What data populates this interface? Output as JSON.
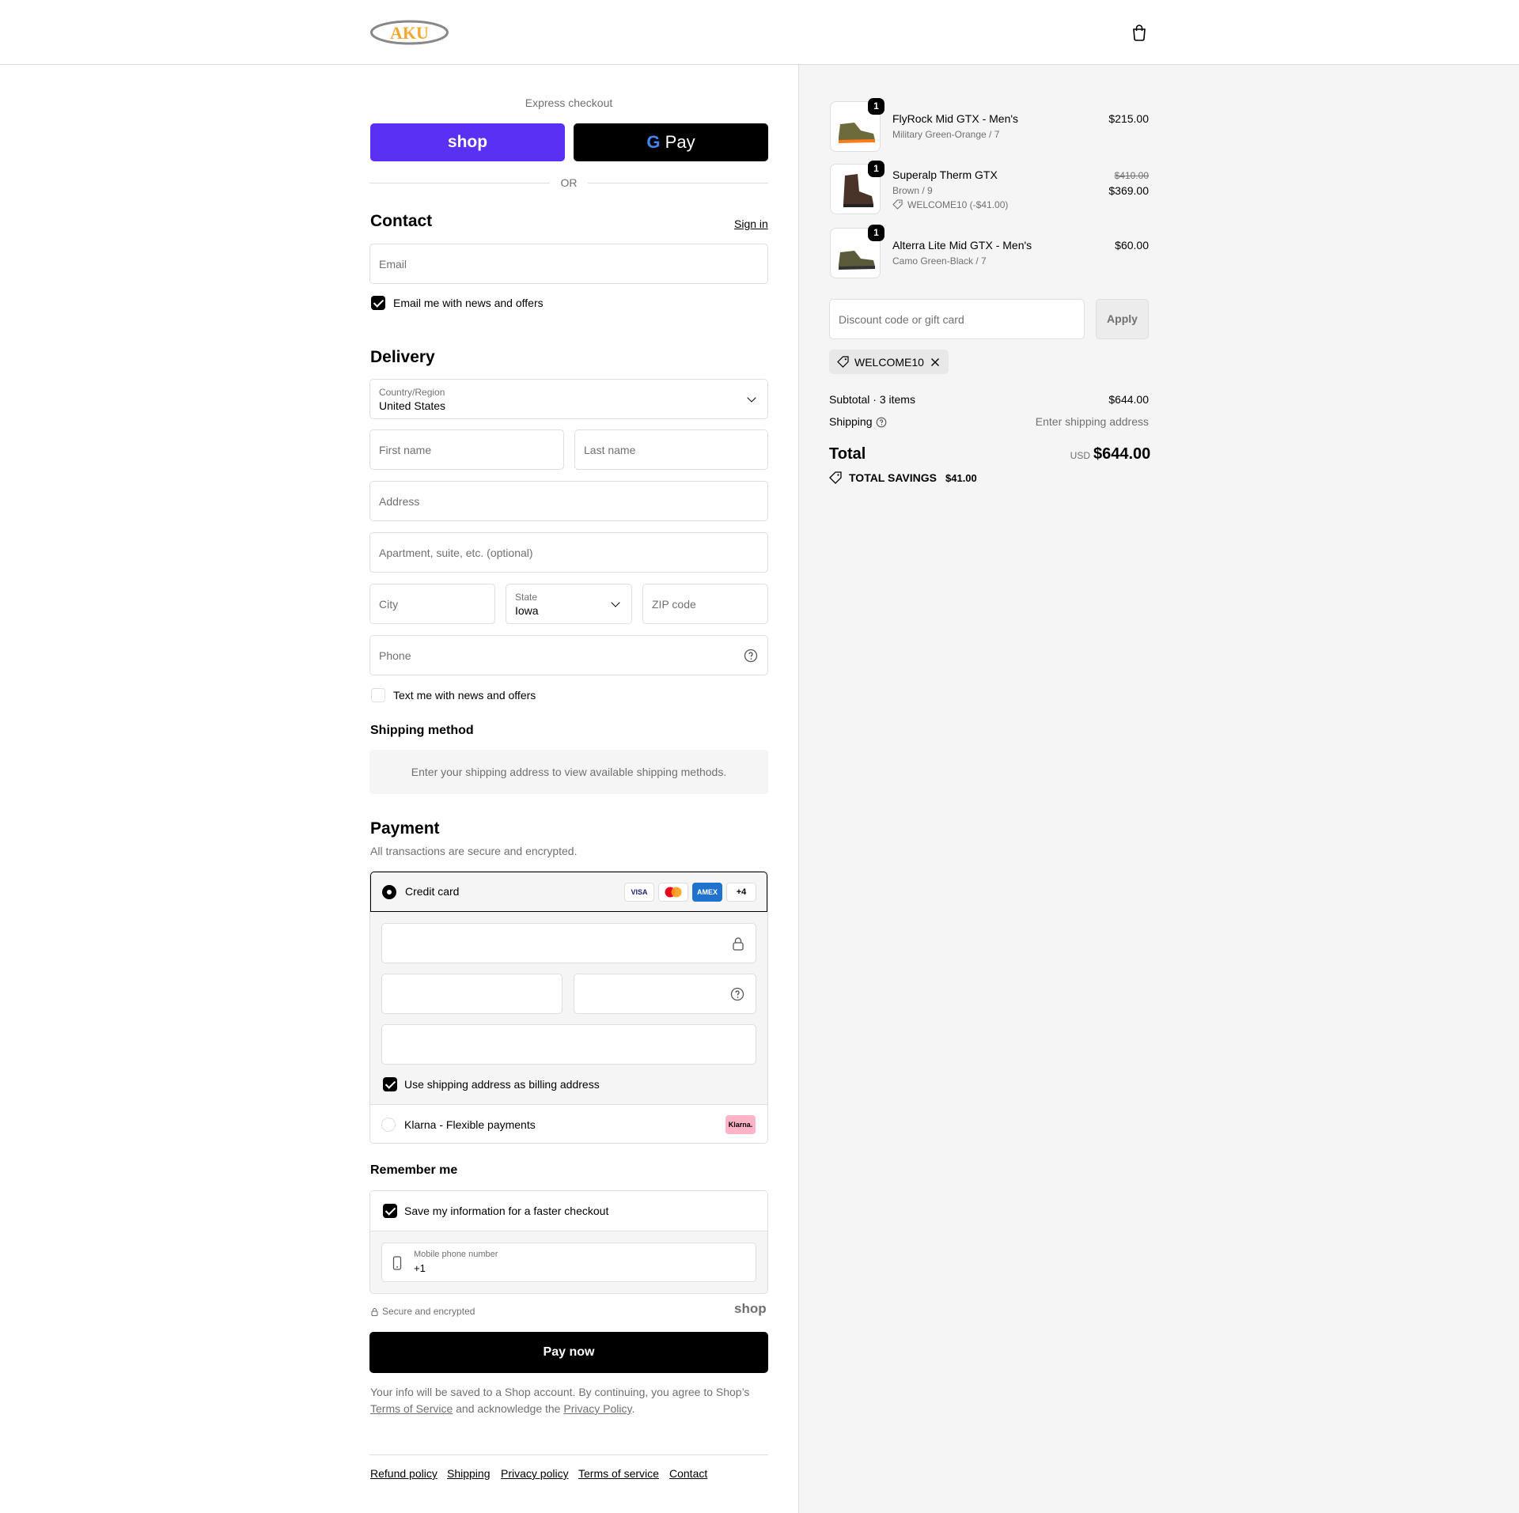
{
  "brand": {
    "logo_text": "AKU"
  },
  "express": {
    "title": "Express checkout",
    "shop_label": "shop",
    "gpay_label": "Pay",
    "or_label": "OR"
  },
  "contact": {
    "title": "Contact",
    "sign_in": "Sign in",
    "email_placeholder": "Email",
    "news_label": "Email me with news and offers"
  },
  "delivery": {
    "title": "Delivery",
    "country_label": "Country/Region",
    "country_value": "United States",
    "first_name": "First name",
    "last_name": "Last name",
    "address": "Address",
    "apartment": "Apartment, suite, etc. (optional)",
    "city": "City",
    "state_label": "State",
    "state_value": "Iowa",
    "zip": "ZIP code",
    "phone": "Phone",
    "text_news": "Text me with news and offers"
  },
  "shipping_method": {
    "title": "Shipping method",
    "notice": "Enter your shipping address to view available shipping methods."
  },
  "payment": {
    "title": "Payment",
    "subtitle": "All transactions are secure and encrypted.",
    "credit_card": "Credit card",
    "cards": [
      "VISA",
      "MC",
      "AMEX"
    ],
    "more_cards": "+4",
    "billing_same": "Use shipping address as billing address",
    "klarna": "Klarna - Flexible payments",
    "klarna_badge": "Klarna."
  },
  "remember": {
    "title": "Remember me",
    "save_label": "Save my information for a faster checkout",
    "mobile_label": "Mobile phone number",
    "mobile_value": "+1"
  },
  "secure": {
    "label": "Secure and encrypted",
    "shop": "shop"
  },
  "pay_now": "Pay now",
  "legal": {
    "text1": "Your info will be saved to a Shop account. By continuing, you agree to Shop’s",
    "tos": "Terms of Service",
    "text2": "and acknowledge the",
    "privacy": "Privacy Policy",
    "end": "."
  },
  "footer": [
    "Refund policy",
    "Shipping",
    "Privacy policy",
    "Terms of service",
    "Contact"
  ],
  "cart": {
    "items": [
      {
        "qty": "1",
        "name": "FlyRock Mid GTX - Men's",
        "variant": "Military Green-Orange / 7",
        "price": "$215.00"
      },
      {
        "qty": "1",
        "name": "Superalp Therm GTX",
        "variant": "Brown / 9",
        "discount": "WELCOME10 (-$41.00)",
        "old_price": "$410.00",
        "price": "$369.00"
      },
      {
        "qty": "1",
        "name": "Alterra Lite Mid GTX - Men's",
        "variant": "Camo Green-Black / 7",
        "price": "$60.00"
      }
    ],
    "discount_placeholder": "Discount code or gift card",
    "apply": "Apply",
    "applied_code": "WELCOME10",
    "subtotal_label": "Subtotal · 3 items",
    "subtotal_value": "$644.00",
    "shipping_label": "Shipping",
    "shipping_value": "Enter shipping address",
    "total_label": "Total",
    "currency": "USD",
    "total_value": "$644.00",
    "savings_label": "TOTAL SAVINGS",
    "savings_value": "$41.00"
  },
  "colors": {
    "shop_purple": "#5a31f4",
    "logo_orange": "#f0a830",
    "klarna_pink": "#ffb3c7"
  }
}
